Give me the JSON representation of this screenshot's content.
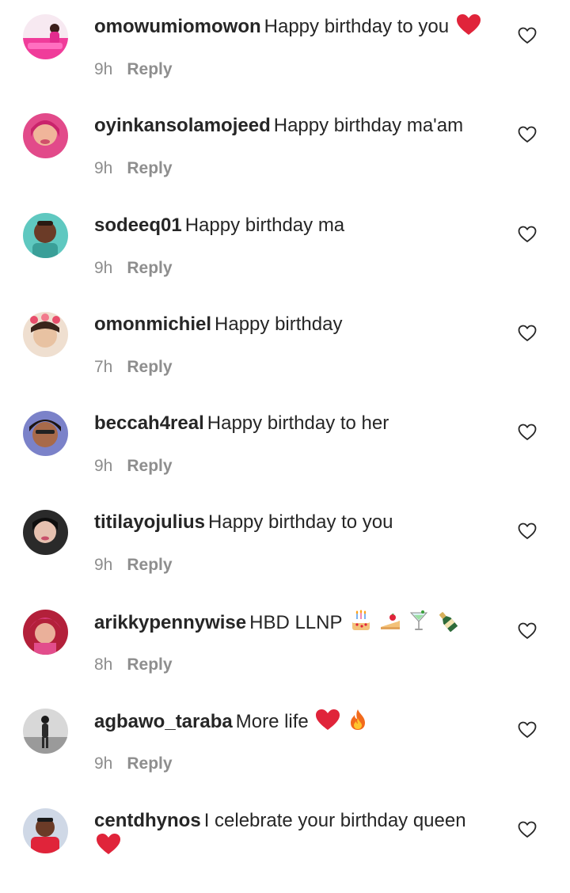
{
  "comments": [
    {
      "username": "omowumiomowon",
      "text": "Happy birthday to you",
      "time": "9h",
      "reply": "Reply"
    },
    {
      "username": "oyinkansolamojeed",
      "text": "Happy birthday ma'am",
      "time": "9h",
      "reply": "Reply"
    },
    {
      "username": "sodeeq01",
      "text": "Happy birthday ma",
      "time": "9h",
      "reply": "Reply"
    },
    {
      "username": "omonmichiel",
      "text": "Happy birthday",
      "time": "7h",
      "reply": "Reply"
    },
    {
      "username": "beccah4real",
      "text": "Happy birthday to her",
      "time": "9h",
      "reply": "Reply"
    },
    {
      "username": "titilayojulius",
      "text": "Happy birthday to you",
      "time": "9h",
      "reply": "Reply"
    },
    {
      "username": "arikkypennywise",
      "text": "HBD LLNP",
      "time": "8h",
      "reply": "Reply"
    },
    {
      "username": "agbawo_taraba",
      "text": "More life",
      "time": "9h",
      "reply": "Reply"
    },
    {
      "username": "centdhynos",
      "text": "I celebrate your birthday queen",
      "time": "",
      "reply": ""
    }
  ],
  "icons": {
    "like": "heart-outline-icon",
    "red_heart": "red-heart-emoji",
    "cake": "birthday-cake-emoji",
    "cake_slice": "shortcake-emoji",
    "cocktail": "cocktail-glass-emoji",
    "bottle": "champagne-bottle-emoji",
    "fire": "fire-emoji"
  },
  "colors": {
    "username": "#262626",
    "meta": "#8e8e8e",
    "heart_red": "#e0243a"
  }
}
